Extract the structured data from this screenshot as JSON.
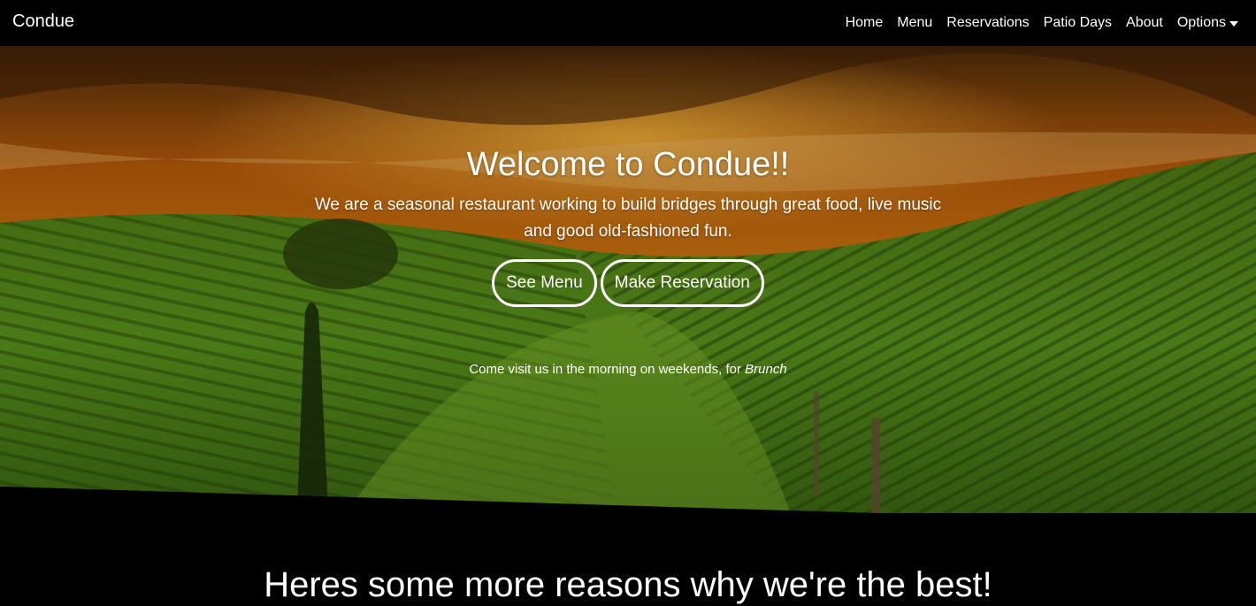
{
  "navbar": {
    "brand": "Condue",
    "links": [
      "Home",
      "Menu",
      "Reservations",
      "Patio Days",
      "About"
    ],
    "dropdown_label": "Options"
  },
  "hero": {
    "title": "Welcome to Condue!!",
    "subtitle": "We are a seasonal restaurant working to build bridges through great food, live music and good old-fashioned fun.",
    "buttons": {
      "menu": "See Menu",
      "reservation": "Make Reservation"
    },
    "note_prefix": "Come visit us in the morning on weekends, for ",
    "note_emphasis": "Brunch"
  },
  "section": {
    "heading": "Heres some more reasons why we're the best!"
  },
  "colors": {
    "navbar_bg": "#000000",
    "text": "#ffffff",
    "sky_orange": "#d9740f",
    "field_green": "#5f9a1f"
  }
}
